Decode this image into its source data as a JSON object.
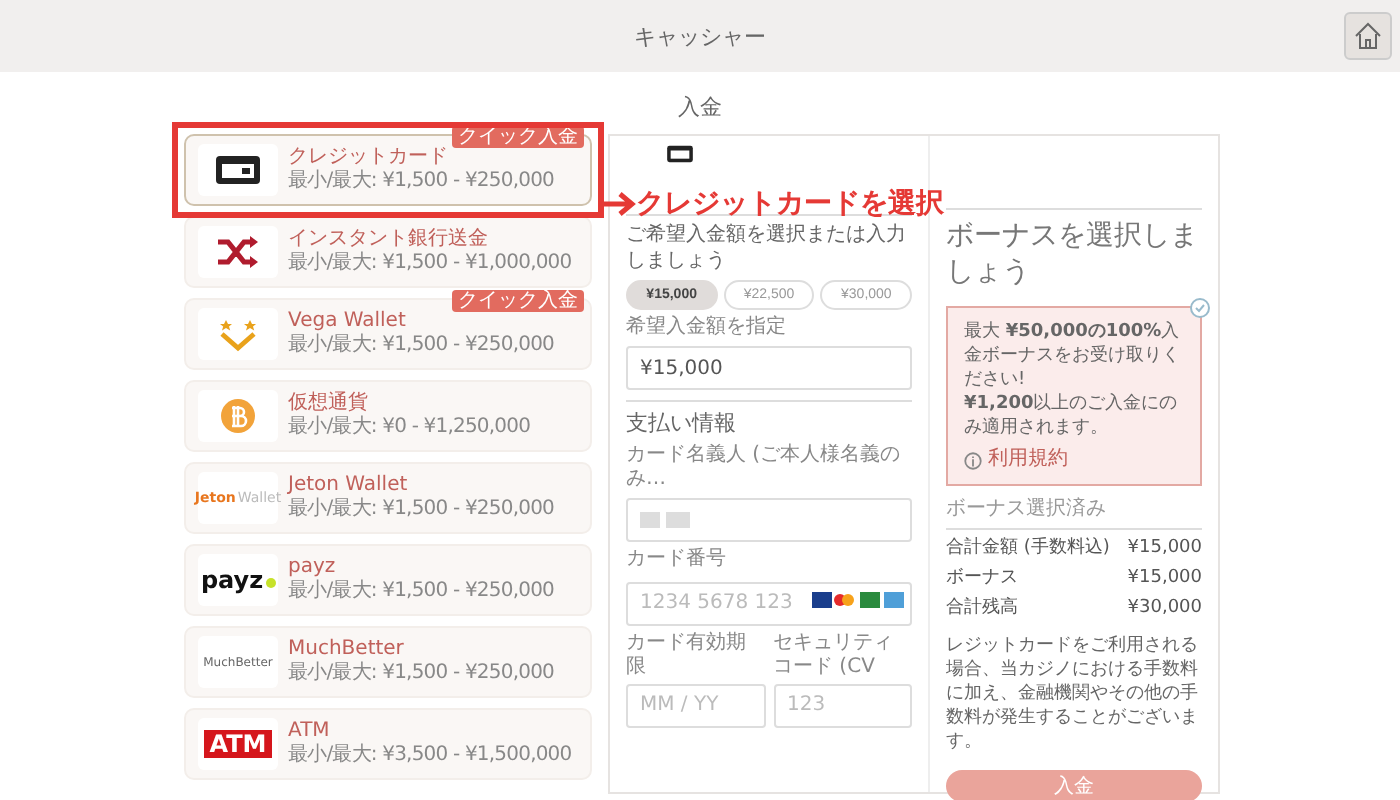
{
  "header": {
    "title": "キャッシャー"
  },
  "page_title": "入金",
  "methods": [
    {
      "kind": "card",
      "name": "クレジットカード",
      "range": "最小/最大: ¥1,500 - ¥250,000",
      "badge": "クイック入金",
      "selected": true
    },
    {
      "kind": "shuffle",
      "name": "インスタント銀行送金",
      "range": "最小/最大: ¥1,500 - ¥1,000,000",
      "selected": false
    },
    {
      "kind": "vega",
      "name": "Vega Wallet",
      "range": "最小/最大: ¥1,500 - ¥250,000",
      "badge": "クイック入金",
      "selected": false
    },
    {
      "kind": "bitcoin",
      "name": "仮想通貨",
      "range": "最小/最大: ¥0 - ¥1,250,000",
      "selected": false
    },
    {
      "kind": "jeton",
      "logo_text": [
        "Jeton",
        "Wallet"
      ],
      "name": "Jeton Wallet",
      "range": "最小/最大: ¥1,500 - ¥250,000",
      "selected": false
    },
    {
      "kind": "payz",
      "logo_text": "payz",
      "name": "payz",
      "range": "最小/最大: ¥1,500 - ¥250,000",
      "selected": false
    },
    {
      "kind": "muchbetter",
      "logo_text": "MuchBetter",
      "name": "MuchBetter",
      "range": "最小/最大: ¥1,500 - ¥250,000",
      "selected": false
    },
    {
      "kind": "atm",
      "logo_text": "ATM",
      "name": "ATM",
      "range": "最小/最大: ¥3,500 - ¥1,500,000",
      "selected": false
    }
  ],
  "annotation": {
    "text": "クレジットカードを選択"
  },
  "deposit": {
    "prompt": "ご希望入金額を選択または入力しましょう",
    "amounts": [
      {
        "label": "¥15,000",
        "selected": true
      },
      {
        "label": "¥22,500",
        "selected": false
      },
      {
        "label": "¥30,000",
        "selected": false
      }
    ],
    "amount_label": "希望入金額を指定",
    "amount_value": "¥15,000"
  },
  "payment": {
    "title": "支払い情報",
    "name_label": "カード名義人 (ご本人様名義のみ…",
    "number_label": "カード番号",
    "number_placeholder": "1234 5678 123",
    "expiry_label": "カード有効期限",
    "expiry_placeholder": "MM / YY",
    "cvv_label": "セキュリティコード (CV",
    "cvv_placeholder": "123"
  },
  "bonus": {
    "title": "ボーナスを選択しましょう",
    "selected": true,
    "lines": [
      "最大 **¥50,000の100%**入金ボーナスをお受け取りください!",
      "**¥1,200**以上のご入金にのみ適用されます。"
    ],
    "terms": "利用規約",
    "status": "ボーナス選択済み"
  },
  "summary": [
    {
      "label": "合計金額 (手数料込)",
      "value": "¥15,000"
    },
    {
      "label": "ボーナス",
      "value": "¥15,000"
    },
    {
      "label": "合計残高",
      "value": "¥30,000"
    }
  ],
  "note": "レジットカードをご利用される場合、当カジノにおける手数料に加え、金融機関やその他の手数料が発生することがございます。",
  "submit": "入金"
}
